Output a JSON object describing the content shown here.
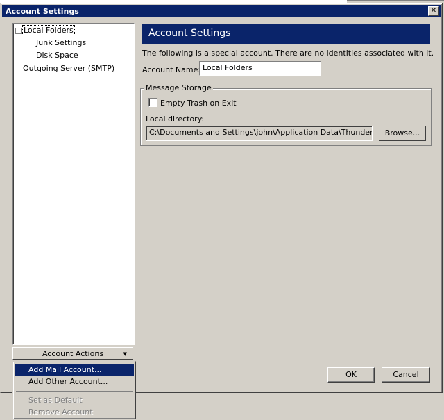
{
  "window": {
    "title": "Account Settings",
    "close_glyph": "✕"
  },
  "tree": {
    "expander_glyph": "−",
    "items": [
      {
        "label": "Local Folders"
      },
      {
        "label": "Junk Settings"
      },
      {
        "label": "Disk Space"
      },
      {
        "label": "Outgoing Server (SMTP)"
      }
    ]
  },
  "account_actions": {
    "label": "Account Actions",
    "arrow": "▼",
    "menu": [
      {
        "label": "Add Mail Account...",
        "state": "highlighted"
      },
      {
        "label": "Add Other Account...",
        "state": "enabled"
      },
      {
        "label": "Set as Default",
        "state": "disabled"
      },
      {
        "label": "Remove Account",
        "state": "disabled"
      }
    ]
  },
  "panel": {
    "header": "Account Settings",
    "description": "The following is a special account. There are no identities associated with it.",
    "account_name_label": "Account Name:",
    "account_name_value": "Local Folders",
    "storage": {
      "legend": "Message Storage",
      "empty_trash_label": "Empty Trash on Exit",
      "empty_trash_checked": false,
      "local_dir_label": "Local directory:",
      "local_dir_value": "C:\\Documents and Settings\\john\\Application Data\\Thunderbird\\Profiles",
      "browse_label": "Browse..."
    }
  },
  "footer": {
    "ok_label": "OK",
    "cancel_label": "Cancel"
  },
  "colors": {
    "title_bar": "#0a246a",
    "face": "#d4d0c8",
    "highlight": "#0a246a"
  }
}
